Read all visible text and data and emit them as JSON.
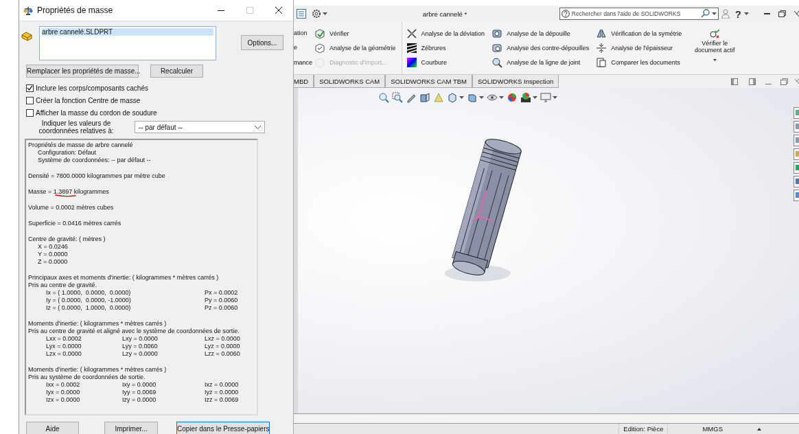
{
  "dialog": {
    "title": "Propriétés de masse",
    "file_list": [
      {
        "label": "arbre cannelé.SLDPRT",
        "selected": true
      }
    ],
    "options_button": "Options...",
    "actions": [
      "Remplacer les propriétés de masse...",
      "Recalculer"
    ],
    "checkboxes": [
      {
        "label": "Inclure les corps/composants cachés",
        "checked": true
      },
      {
        "label": "Créer la fonction Centre de masse",
        "checked": false
      },
      {
        "label": "Afficher la masse du cordon de soudure",
        "checked": false
      }
    ],
    "coord_label": "Indiquer les valeurs de coordonnées relatives à:",
    "coord_select": {
      "value": "-- par défaut --"
    },
    "results": [
      {
        "kind": "block",
        "title": "Propriétés de masse de arbre cannelé",
        "lines": [
          "Configuration: Défaut",
          "Système de coordonnées: -- par défaut --"
        ]
      },
      {
        "kind": "line",
        "text": "Densité = 7800.0000 kilogrammes par mètre cube",
        "underlined": false
      },
      {
        "kind": "line",
        "text": "Masse = 1.3897 kilogrammes",
        "underlined": true
      },
      {
        "kind": "line",
        "text": "Volume = 0.0002 mètres cubes",
        "underlined": false
      },
      {
        "kind": "line",
        "text": "Superficie = 0.0416 mètres carrés",
        "underlined": false
      },
      {
        "kind": "block",
        "title": "Centre de gravité: ( mètres )",
        "lines": [
          "X = 0.0246",
          "Y = 0.0000",
          "Z = 0.0000"
        ]
      },
      {
        "kind": "table",
        "lines": [
          "Principaux axes et moments d'inertie: ( kilogrammes * mètres carrés )",
          "Pris au centre de gravité."
        ],
        "rows": [
          [
            "Ix = ( 1.0000,  0.0000,  0.0000)",
            "Px = 0.0002"
          ],
          [
            "Iy = ( 0.0000,  0.0000, -1.0000)",
            "Py = 0.0060"
          ],
          [
            "Iz = ( 0.0000,  1.0000,  0.0000)",
            "Pz = 0.0060"
          ]
        ]
      },
      {
        "kind": "table",
        "lines": [
          "Moments d'inertie: ( kilogrammes * mètres carrés )",
          "Pris au centre de gravité et aligné avec le système de coordonnées de sortie."
        ],
        "rows": [
          [
            "Lxx = 0.0002",
            "Lxy = 0.0000",
            "Lxz = 0.0000"
          ],
          [
            "Lyx = 0.0000",
            "Lyy = 0.0060",
            "Lyz = 0.0000"
          ],
          [
            "Lzx = 0.0000",
            "Lzy = 0.0000",
            "Lzz = 0.0060"
          ]
        ]
      },
      {
        "kind": "table",
        "lines": [
          "Moments d'inertie: ( kilogrammes * mètres carrés )",
          "Pris au système de coordonnées de sortie."
        ],
        "rows": [
          [
            "Ixx = 0.0002",
            "Ixy = 0.0000",
            "Ixz = 0.0000"
          ],
          [
            "Iyx = 0.0000",
            "Iyy = 0.0069",
            "Iyz = 0.0000"
          ],
          [
            "Izx = 0.0000",
            "Izy = 0.0000",
            "Izz = 0.0069"
          ]
        ]
      }
    ],
    "buttons": [
      {
        "label": "Aide",
        "focused": false
      },
      {
        "label": "Imprimer...",
        "focused": false
      },
      {
        "label": "Copier dans le Presse-papiers",
        "focused": true
      }
    ]
  },
  "app": {
    "title": "arbre cannelé *",
    "search": {
      "placeholder": "Rechercher dans l'aide de SOLIDWORKS"
    },
    "help_glyph": "?",
    "ribbon": {
      "cut_labels": [
        "ation",
        "e",
        "mance"
      ],
      "columns": [
        [
          {
            "label": "Vérifier",
            "disabled": false
          },
          {
            "label": "Analyse de la géométrie",
            "disabled": false
          },
          {
            "label": "Diagnostic d'import...",
            "disabled": true
          }
        ],
        [
          {
            "label": "Analyse de la déviation",
            "disabled": false
          },
          {
            "label": "Zébrures",
            "disabled": false
          },
          {
            "label": "Courbure",
            "disabled": false
          }
        ],
        [
          {
            "label": "Analyse de la dépouille",
            "disabled": false
          },
          {
            "label": "Analyse des contre-dépouilles",
            "disabled": false
          },
          {
            "label": "Analyse de la ligne de joint",
            "disabled": false
          }
        ],
        [
          {
            "label": "Vérification de la symétrie",
            "disabled": false
          },
          {
            "label": "Analyse de l'épaisseur",
            "disabled": false
          },
          {
            "label": "Comparer les documents",
            "disabled": false
          }
        ]
      ],
      "large_button": "Vérifier le document actif"
    },
    "tabs": [
      {
        "label": "MBD",
        "selected": false
      },
      {
        "label": "SOLIDWORKS CAM",
        "selected": false
      },
      {
        "label": "SOLIDWORKS CAM TBM",
        "selected": false
      },
      {
        "label": "SOLIDWORKS Inspection",
        "selected": false
      }
    ],
    "status_bar": [
      "Edition: Pièce",
      "MMGS"
    ]
  }
}
